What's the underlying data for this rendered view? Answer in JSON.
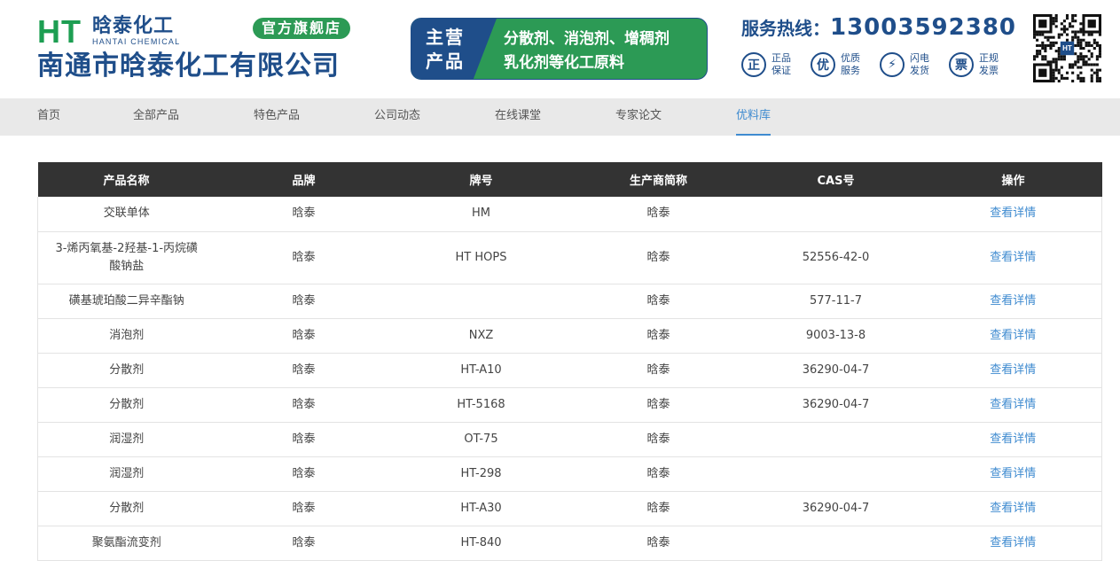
{
  "header": {
    "logo_ht": "HT",
    "logo_cn": "晗泰化工",
    "logo_en": "HANTAI CHEMICAL",
    "store_badge": "官方旗舰店",
    "company_name": "南通市晗泰化工有限公司",
    "main_business_label_1": "主营",
    "main_business_label_2": "产品",
    "main_business_line_1": "分散剂、消泡剂、增稠剂",
    "main_business_line_2": "乳化剂等化工原料",
    "hotline_label": "服务热线：",
    "hotline_number": "13003592380",
    "guarantees": [
      {
        "icon": "正",
        "line1": "正品",
        "line2": "保证"
      },
      {
        "icon": "优",
        "line1": "优质",
        "line2": "服务"
      },
      {
        "icon": "⚡",
        "line1": "闪电",
        "line2": "发货"
      },
      {
        "icon": "票",
        "line1": "正规",
        "line2": "发票"
      }
    ],
    "qr_label": "HT"
  },
  "nav": {
    "items": [
      {
        "label": "首页"
      },
      {
        "label": "全部产品"
      },
      {
        "label": "特色产品"
      },
      {
        "label": "公司动态"
      },
      {
        "label": "在线课堂"
      },
      {
        "label": "专家论文"
      },
      {
        "label": "优料库"
      }
    ],
    "active_index": 6
  },
  "table": {
    "headers": [
      "产品名称",
      "品牌",
      "牌号",
      "生产商简称",
      "CAS号",
      "操作"
    ],
    "rows": [
      {
        "name": "交联单体",
        "brand": "晗泰",
        "grade": "HM",
        "maker": "晗泰",
        "cas": "",
        "action": "查看详情"
      },
      {
        "name": "3-烯丙氧基-2羟基-1-丙烷磺酸钠盐",
        "brand": "晗泰",
        "grade": "HT HOPS",
        "maker": "晗泰",
        "cas": "52556-42-0",
        "action": "查看详情"
      },
      {
        "name": "磺基琥珀酸二异辛酯钠",
        "brand": "晗泰",
        "grade": "",
        "maker": "晗泰",
        "cas": "577-11-7",
        "action": "查看详情"
      },
      {
        "name": "消泡剂",
        "brand": "晗泰",
        "grade": "NXZ",
        "maker": "晗泰",
        "cas": "9003-13-8",
        "action": "查看详情"
      },
      {
        "name": "分散剂",
        "brand": "晗泰",
        "grade": "HT-A10",
        "maker": "晗泰",
        "cas": "36290-04-7",
        "action": "查看详情"
      },
      {
        "name": "分散剂",
        "brand": "晗泰",
        "grade": "HT-5168",
        "maker": "晗泰",
        "cas": "36290-04-7",
        "action": "查看详情"
      },
      {
        "name": "润湿剂",
        "brand": "晗泰",
        "grade": "OT-75",
        "maker": "晗泰",
        "cas": "",
        "action": "查看详情"
      },
      {
        "name": "润湿剂",
        "brand": "晗泰",
        "grade": "HT-298",
        "maker": "晗泰",
        "cas": "",
        "action": "查看详情"
      },
      {
        "name": "分散剂",
        "brand": "晗泰",
        "grade": "HT-A30",
        "maker": "晗泰",
        "cas": "36290-04-7",
        "action": "查看详情"
      },
      {
        "name": "聚氨酯流变剂",
        "brand": "晗泰",
        "grade": "HT-840",
        "maker": "晗泰",
        "cas": "",
        "action": "查看详情"
      }
    ]
  },
  "colors": {
    "brand_blue": "#1f4e8a",
    "brand_green": "#2c9a55",
    "link_blue": "#3f8bd0",
    "table_header_bg": "#333333"
  }
}
